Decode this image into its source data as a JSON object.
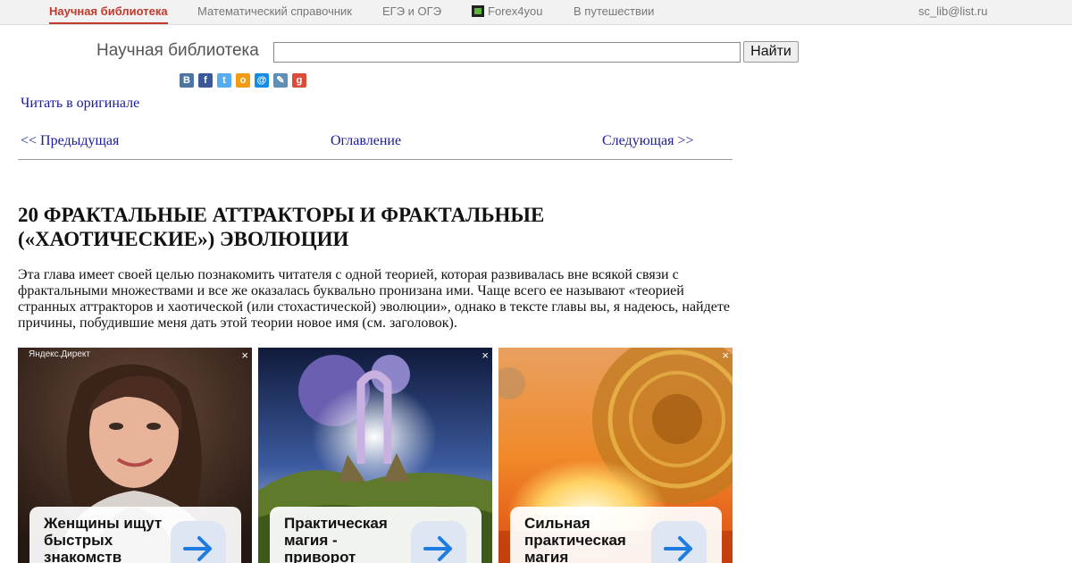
{
  "topnav": {
    "items": [
      {
        "label": "Научная библиотека"
      },
      {
        "label": "Математический справочник"
      },
      {
        "label": "ЕГЭ и ОГЭ"
      },
      {
        "label": "Forex4you"
      },
      {
        "label": "В путешествии"
      }
    ],
    "email": "sc_lib@list.ru"
  },
  "search": {
    "label": "Научная библиотека",
    "value": "",
    "button": "Найти"
  },
  "share": {
    "icons": [
      {
        "name": "vkontakte-icon",
        "glyph": "В",
        "color": "#4c75a3"
      },
      {
        "name": "facebook-icon",
        "glyph": "f",
        "color": "#3b5998"
      },
      {
        "name": "twitter-icon",
        "glyph": "t",
        "color": "#55acee"
      },
      {
        "name": "odnoklassniki-icon",
        "glyph": "о",
        "color": "#f39c12"
      },
      {
        "name": "mailru-icon",
        "glyph": "@",
        "color": "#168de2"
      },
      {
        "name": "livejournal-icon",
        "glyph": "✎",
        "color": "#5f8fb5"
      },
      {
        "name": "googleplus-icon",
        "glyph": "g",
        "color": "#dd4b39"
      }
    ]
  },
  "read_original": "Читать в оригинале",
  "nav": {
    "prev": "<< Предыдущая",
    "toc": "Оглавление",
    "next": "Следующая >>"
  },
  "article": {
    "title": "20 ФРАКТАЛЬНЫЕ АТТРАКТОРЫ И ФРАКТАЛЬНЫЕ («ХАОТИЧЕСКИЕ») ЭВОЛЮЦИИ",
    "paragraph": "Эта глава имеет своей целью познакомить читателя с одной теорией, которая развивалась вне всякой связи с фрактальными множествами и все же оказалась буквально пронизана ими. Чаще всего ее называют «теорией странных аттракторов и хаотической (или стохастической) эволюции», однако в тексте главы вы, я надеюсь, найдете причины, побудившие меня дать этой теории новое имя (см. заголовок)."
  },
  "ads": {
    "source": "Яндекс.Директ",
    "close": "×",
    "items": [
      {
        "text": "Женщины ищут быстрых знакомств"
      },
      {
        "text": "Практическая магия - приворот"
      },
      {
        "text": "Сильная практическая магия"
      }
    ]
  }
}
